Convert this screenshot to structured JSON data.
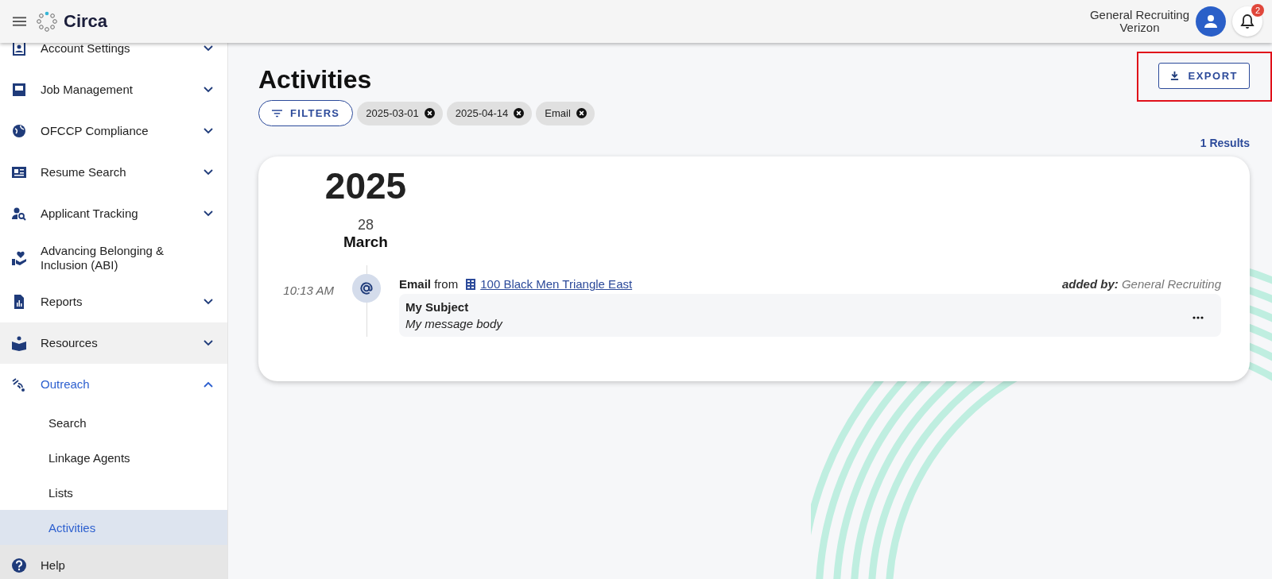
{
  "header": {
    "logo": "Circa",
    "user_name": "General Recruiting",
    "company": "Verizon",
    "notification_count": "2"
  },
  "sidebar": {
    "items": [
      {
        "label": "Account Settings",
        "expandable": true,
        "expanded": false,
        "hovered": false
      },
      {
        "label": "Job Management",
        "expandable": true,
        "expanded": false,
        "hovered": false
      },
      {
        "label": "OFCCP Compliance",
        "expandable": true,
        "expanded": false,
        "hovered": false
      },
      {
        "label": "Resume Search",
        "expandable": true,
        "expanded": false,
        "hovered": false
      },
      {
        "label": "Applicant Tracking",
        "expandable": true,
        "expanded": false,
        "hovered": false
      },
      {
        "label": "Advancing Belonging & Inclusion (ABI)",
        "expandable": false,
        "expanded": false,
        "hovered": false
      },
      {
        "label": "Reports",
        "expandable": true,
        "expanded": false,
        "hovered": false
      },
      {
        "label": "Resources",
        "expandable": true,
        "expanded": false,
        "hovered": true
      },
      {
        "label": "Outreach",
        "expandable": true,
        "expanded": true,
        "hovered": false,
        "children": [
          {
            "label": "Search",
            "selected": false
          },
          {
            "label": "Linkage Agents",
            "selected": false
          },
          {
            "label": "Lists",
            "selected": false
          },
          {
            "label": "Activities",
            "selected": true
          }
        ]
      },
      {
        "label": "Help",
        "expandable": false,
        "expanded": false,
        "hovered": false
      }
    ]
  },
  "page": {
    "title": "Activities",
    "filters_button": "FILTERS",
    "export_button": "EXPORT",
    "export_highlighted": true,
    "chips": [
      {
        "label": "2025-03-01"
      },
      {
        "label": "2025-04-14"
      },
      {
        "label": "Email"
      }
    ],
    "results": "1 Results"
  },
  "timeline": {
    "year": "2025",
    "day": "28",
    "month": "March",
    "entries": [
      {
        "time": "10:13 AM",
        "type": "Email",
        "from_word": "from",
        "source": "100 Black Men Triangle East",
        "added_by_label": "added by:",
        "added_by": "General Recruiting",
        "subject": "My Subject",
        "body": "My message body"
      }
    ]
  }
}
